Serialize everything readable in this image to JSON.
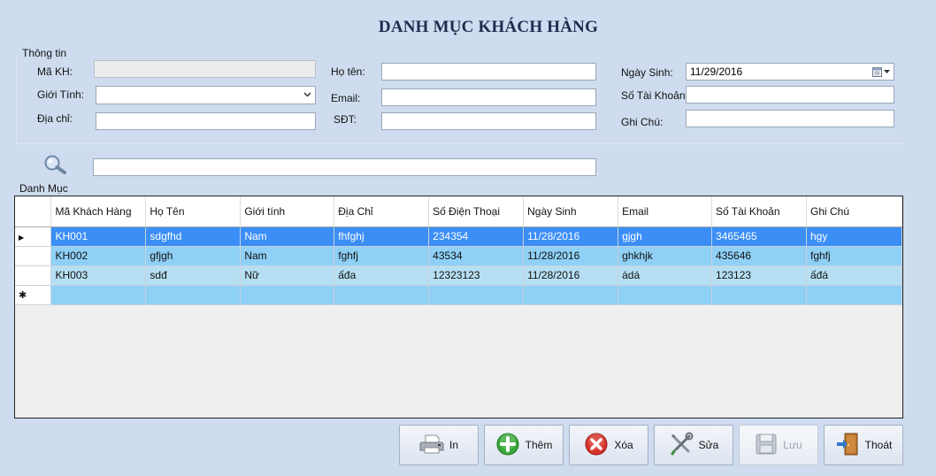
{
  "title": "DANH MỤC KHÁCH HÀNG",
  "info_group": {
    "caption": "Thông tin",
    "ma_kh": {
      "label": "Mã KH:",
      "value": ""
    },
    "gioi_tinh": {
      "label": "Giới Tính:",
      "value": ""
    },
    "dia_chi": {
      "label": "Địa chỉ:",
      "value": ""
    },
    "ho_ten": {
      "label": "Họ tên:",
      "value": ""
    },
    "email": {
      "label": "Email:",
      "value": ""
    },
    "sdt": {
      "label": "SĐT:",
      "value": ""
    },
    "ngay_sinh": {
      "label": "Ngày Sinh:",
      "value": "11/29/2016"
    },
    "so_tai_khoan": {
      "label": "Số Tài Khoản:",
      "value": ""
    },
    "ghi_chu": {
      "label": "Ghi Chú:",
      "value": ""
    }
  },
  "search": {
    "value": ""
  },
  "list_caption": "Danh Mục",
  "grid": {
    "columns": [
      "Mã Khách Hàng",
      "Họ Tên",
      "Giới tính",
      "Địa Chỉ",
      "Số Điện Thoại",
      "Ngày Sinh",
      "Email",
      "Số Tài Khoản",
      "Ghi Chú"
    ],
    "rows": [
      [
        "KH001",
        "sdgfhd",
        "Nam",
        "fhfghj",
        "234354",
        "11/28/2016",
        "gjgh",
        "3465465",
        "hgy"
      ],
      [
        "KH002",
        "gfjgh",
        "Nam",
        "fghfj",
        "43534",
        "11/28/2016",
        "ghkhjk",
        "435646",
        "fghfj"
      ],
      [
        "KH003",
        "sdđ",
        "Nữ",
        "ấđa",
        "12323123",
        "11/28/2016",
        "ádá",
        "123123",
        "ấđá"
      ]
    ],
    "selected_row_marker": "▶",
    "new_row_marker": "✱"
  },
  "buttons": {
    "print": "In",
    "add": "Thêm",
    "delete": "Xóa",
    "edit": "Sửa",
    "save": "Lưu",
    "exit": "Thoát"
  },
  "colors": {
    "background": "#cfdcef",
    "selected_row": "#3a8ef6",
    "row_alt_1": "#8fd0f7",
    "row_alt_2": "#b7dff3"
  },
  "icons": {
    "search": "magnifier-icon",
    "print": "printer-icon",
    "add": "plus-circle-icon",
    "delete": "x-circle-icon",
    "edit": "tools-icon",
    "save": "floppy-icon",
    "exit": "door-exit-icon"
  }
}
